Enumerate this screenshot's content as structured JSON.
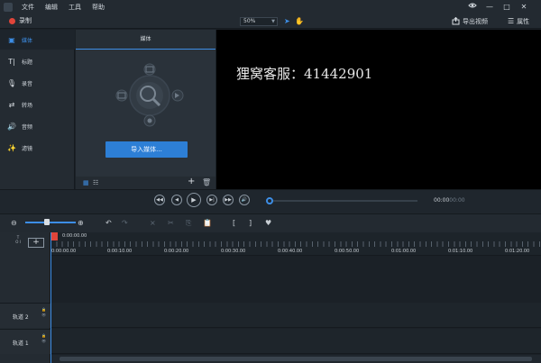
{
  "menu": [
    "文件",
    "编辑",
    "工具",
    "帮助"
  ],
  "window": {
    "minimize": "—",
    "maximize": "□",
    "close": "✕"
  },
  "toolbar": {
    "record_label": "录制",
    "zoom_value": "50%",
    "export_label": "导出视频",
    "properties_label": "属性"
  },
  "sidebar": {
    "items": [
      {
        "label": "媒体",
        "icon": "media-icon"
      },
      {
        "label": "标题",
        "icon": "title-icon"
      },
      {
        "label": "录音",
        "icon": "microphone-icon"
      },
      {
        "label": "转场",
        "icon": "transition-icon"
      },
      {
        "label": "音频",
        "icon": "audio-icon"
      },
      {
        "label": "滤镜",
        "icon": "filter-icon"
      }
    ]
  },
  "media": {
    "header": "媒体",
    "import_label": "导入媒体..."
  },
  "preview": {
    "watermark": "狸窝客服：41442901"
  },
  "playback": {
    "current_time": "00:00",
    "total_time": "00:00"
  },
  "timeline": {
    "playhead_time": "0:00:00.00",
    "ruler_labels": [
      "0:00:00.00",
      "0:00:10.00",
      "0:00:20.00",
      "0:00:30.00",
      "0:00:40.00",
      "0:00:50.00",
      "0:01:00.00",
      "0:01:10.00",
      "0:01:20.00"
    ],
    "tracks": [
      {
        "name": "轨道 2"
      },
      {
        "name": "轨道 1"
      }
    ],
    "vertical_label": "T O I"
  },
  "colors": {
    "accent": "#3d8ee6",
    "record": "#e0453a",
    "import_button": "#2d7fd6"
  }
}
